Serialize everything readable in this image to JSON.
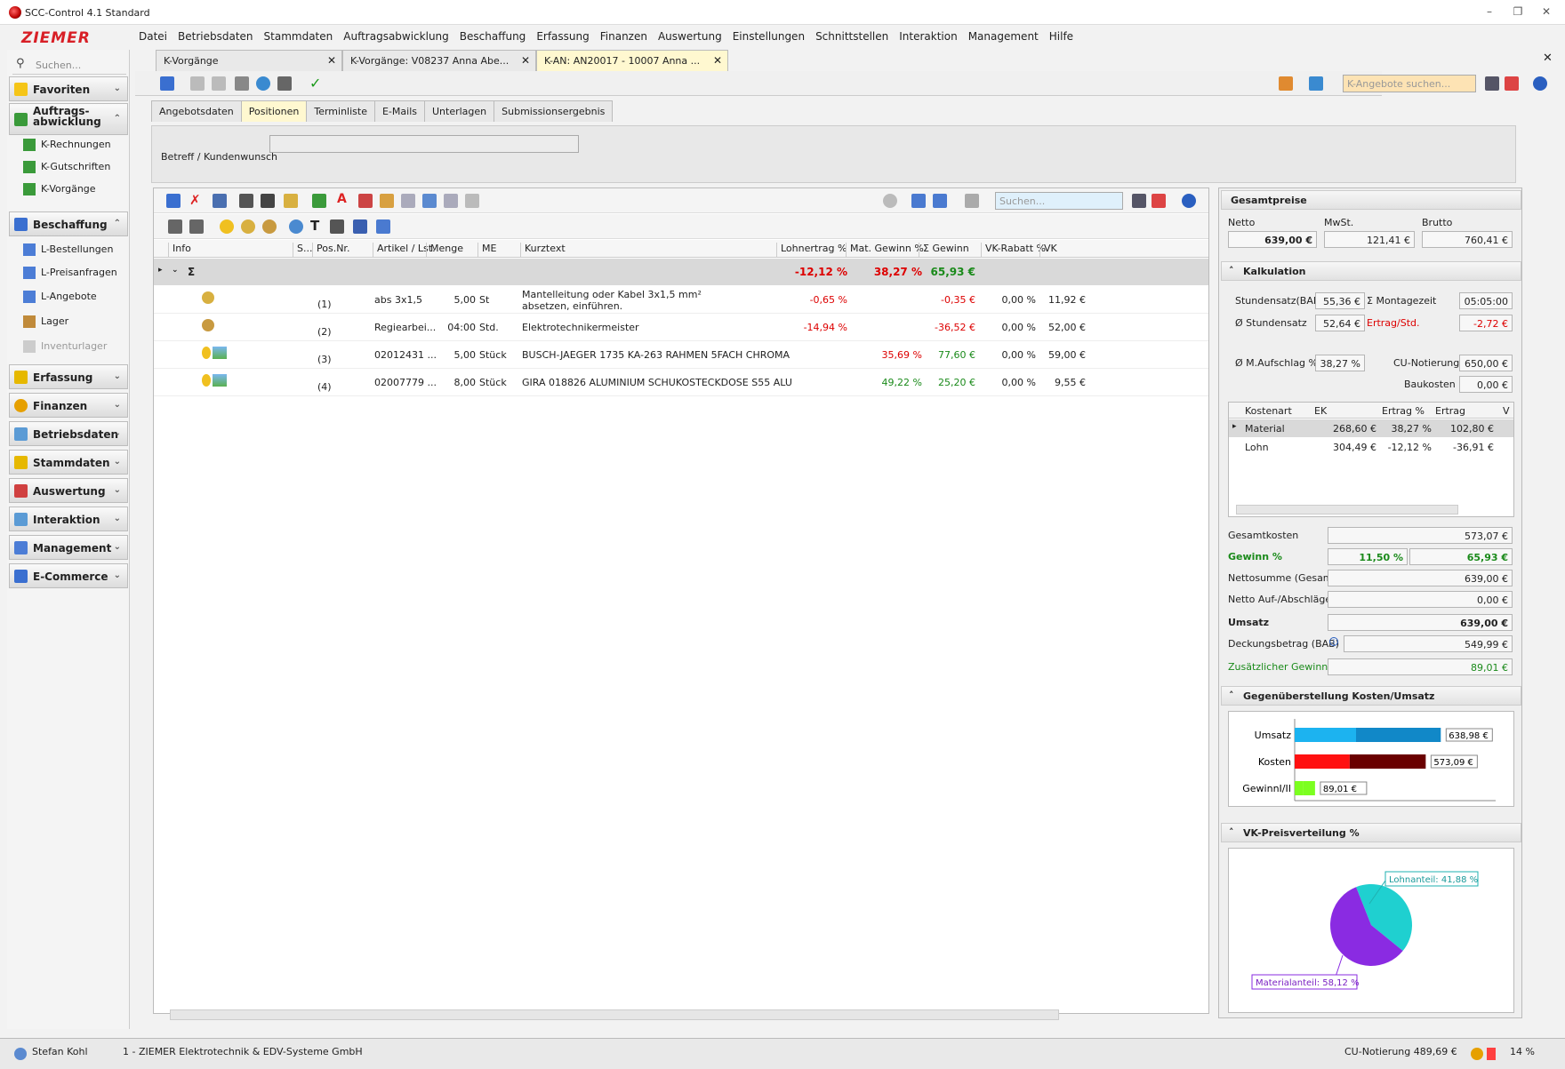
{
  "window": {
    "title": "SCC-Control 4.1 Standard",
    "controls": [
      "–",
      "❐",
      "✕"
    ]
  },
  "brand": {
    "logo_text": "ZIEMER",
    "color": "#d81f26"
  },
  "menu": [
    "Datei",
    "Betriebsdaten",
    "Stammdaten",
    "Auftragsabwicklung",
    "Beschaffung",
    "Erfassung",
    "Finanzen",
    "Auswertung",
    "Einstellungen",
    "Schnittstellen",
    "Interaktion",
    "Management",
    "Hilfe"
  ],
  "doc_tabs": [
    {
      "label": "K-Vorgänge",
      "close": "✕"
    },
    {
      "label": "K-Vorgänge: V08237 Anna Abe...",
      "close": "✕"
    },
    {
      "label": "K-AN: AN20017 - 10007 Anna ...",
      "close": "✕"
    }
  ],
  "tabs_close": "✕",
  "sidebar": {
    "search_placeholder": "Suchen...",
    "groups": [
      {
        "label": "Favoriten",
        "chev": "⌄"
      },
      {
        "label": "Auftrags-\nabwicklung",
        "chev": "⌃"
      },
      {
        "label": "Beschaffung",
        "chev": "⌃"
      },
      {
        "label": "Erfassung",
        "chev": "⌄"
      },
      {
        "label": "Finanzen",
        "chev": "⌄"
      },
      {
        "label": "Betriebsdaten",
        "chev": "⌄"
      },
      {
        "label": "Stammdaten",
        "chev": "⌄"
      },
      {
        "label": "Auswertung",
        "chev": "⌄"
      },
      {
        "label": "Interaktion",
        "chev": "⌄"
      },
      {
        "label": "Management",
        "chev": "⌄"
      },
      {
        "label": "E-Commerce",
        "chev": "⌄"
      }
    ],
    "auftrag_items": [
      "K-Rechnungen",
      "K-Gutschriften",
      "K-Vorgänge"
    ],
    "beschaffung_items": [
      "L-Bestellungen",
      "L-Preisanfragen",
      "L-Angebote",
      "Lager",
      "Inventurlager"
    ]
  },
  "toolbar": {
    "search_placeholder": "K-Angebote suchen..."
  },
  "subtabs": [
    "Angebotsdaten",
    "Positionen",
    "Terminliste",
    "E-Mails",
    "Unterlagen",
    "Submissionsergebnis"
  ],
  "betreff_label": "Betreff / Kundenwunsch",
  "grid": {
    "search_placeholder": "Suchen...",
    "columns": [
      "Info",
      "S...",
      "Pos.Nr.",
      "Artikel / Lst.",
      "Menge",
      "ME",
      "Kurztext",
      "Lohnertrag %",
      "Mat. Gewinn %",
      "Σ Gewinn",
      "VK-Rabatt %",
      "VK"
    ],
    "sum": {
      "sigma": "Σ",
      "lohn": "-12,12 %",
      "mat": "38,27 %",
      "gewinn": "65,93 €"
    },
    "rows": [
      {
        "pos": "(1)",
        "artikel": "abs 3x1,5",
        "menge": "5,00",
        "me": "St",
        "text1": "Mantelleitung oder Kabel 3x1,5 mm²",
        "text2": "absetzen, einführen.",
        "lohn": "-0,65 %",
        "mat": "",
        "gewinn": "-0,35 €",
        "rabatt": "0,00 %",
        "vk": "11,92 €"
      },
      {
        "pos": "(2)",
        "artikel": "Regiearbei...",
        "menge": "04:00",
        "me": "Std.",
        "text1": "Elektrotechnikermeister",
        "text2": "",
        "lohn": "-14,94 %",
        "mat": "",
        "gewinn": "-36,52 €",
        "rabatt": "0,00 %",
        "vk": "52,00 €"
      },
      {
        "pos": "(3)",
        "artikel": "02012431 ...",
        "menge": "5,00",
        "me": "Stück",
        "text1": "BUSCH-JAEGER 1735 KA-263 RAHMEN 5FACH CHROMA",
        "text2": "",
        "lohn": "",
        "mat": "35,69 %",
        "gewinn": "77,60 €",
        "rabatt": "0,00 %",
        "vk": "59,00 €"
      },
      {
        "pos": "(4)",
        "artikel": "02007779 ...",
        "menge": "8,00",
        "me": "Stück",
        "text1": "GIRA 018826 ALUMINIUM SCHUKOSTECKDOSE S55 ALU",
        "text2": "",
        "lohn": "",
        "mat": "49,22 %",
        "gewinn": "25,20 €",
        "rabatt": "0,00 %",
        "vk": "9,55 €"
      }
    ]
  },
  "gesamtpreise": {
    "title": "Gesamtpreise",
    "netto_label": "Netto",
    "mwst_label": "MwSt.",
    "brutto_label": "Brutto",
    "netto": "639,00 €",
    "mwst": "121,41 €",
    "brutto": "760,41 €"
  },
  "kalkulation": {
    "title": "Kalkulation",
    "stundensatz_label": "Stundensatz(BAB)",
    "stundensatz": "55,36 €",
    "montagezeit_label": "Σ Montagezeit",
    "montagezeit": "05:05:00",
    "avg_stundensatz_label": "Ø Stundensatz",
    "avg_stundensatz": "52,64 €",
    "ertrag_label": "Ertrag/Std.",
    "ertrag": "-2,72 €",
    "aufschlag_label": "Ø M.Aufschlag %",
    "aufschlag": "38,27 %",
    "cu_label": "CU-Notierung",
    "cu": "650,00 €",
    "bau_label": "Baukosten",
    "bau": "0,00 €",
    "cost_columns": [
      "Kostenart",
      "EK",
      "Ertrag %",
      "Ertrag",
      "V"
    ],
    "cost_rows": [
      {
        "art": "Material",
        "ek": "268,60 €",
        "ep": "38,27 %",
        "er": "102,80 €"
      },
      {
        "art": "Lohn",
        "ek": "304,49 €",
        "ep": "-12,12 %",
        "er": "-36,91 €"
      }
    ],
    "gesamtkosten_label": "Gesamtkosten",
    "gesamtkosten": "573,07 €",
    "gewinn_label": "Gewinn %",
    "gewinn_pct": "11,50 %",
    "gewinn": "65,93 €",
    "nettosumme_label": "Nettosumme (Gesamt)",
    "nettosumme": "639,00 €",
    "auf_label": "Netto Auf-/Abschläge",
    "auf": "0,00 €",
    "umsatz_label": "Umsatz",
    "umsatz": "639,00 €",
    "deckung_label": "Deckungsbetrag (BAB)",
    "deckung": "549,99 €",
    "zusatz_label": "Zusätzlicher Gewinn I",
    "zusatz": "89,01 €"
  },
  "kosten_chart": {
    "title": "Gegenüberstellung Kosten/Umsatz",
    "bars": [
      {
        "label": "Umsatz",
        "value": 638.98,
        "text": "638,98 €",
        "c1": "#1cb3f0",
        "c2": "#1188c8"
      },
      {
        "label": "Kosten",
        "value": 573.09,
        "text": "573,09 €",
        "c1": "#ff1111",
        "c2": "#6a0000"
      },
      {
        "label": "GewinnI/II",
        "value": 89.01,
        "text": "89,01 €",
        "c1": "#7cff20",
        "c2": "#7cff20"
      }
    ]
  },
  "pie_chart": {
    "title": "VK-Preisverteilung %",
    "slices": [
      {
        "label": "Lohnanteil: 41,88 %",
        "value": 41.88,
        "color": "#1fd0d0"
      },
      {
        "label": "Materialanteil: 58,12 %",
        "value": 58.12,
        "color": "#8a2be2"
      }
    ]
  },
  "status": {
    "user": "Stefan Kohl",
    "company": "1 - ZIEMER Elektrotechnik & EDV-Systeme GmbH",
    "cu": "CU-Notierung 489,69 €",
    "zoom": "14 %"
  }
}
